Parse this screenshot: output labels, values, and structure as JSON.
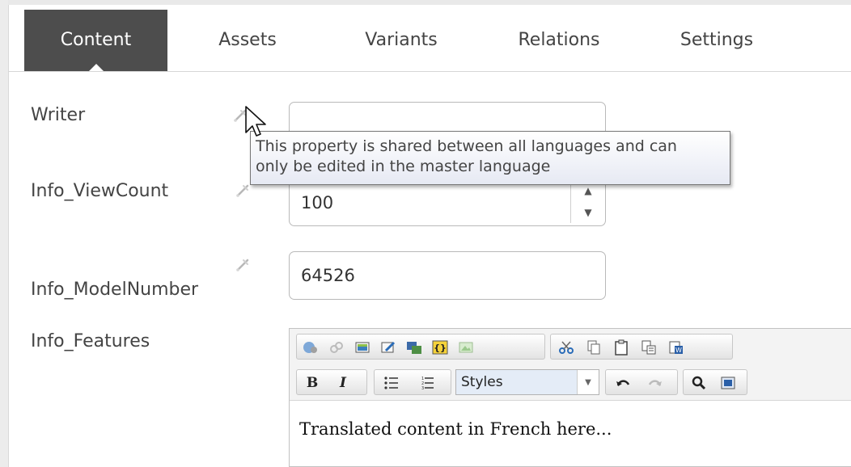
{
  "tabs": [
    {
      "label": "Content",
      "active": true
    },
    {
      "label": "Assets"
    },
    {
      "label": "Variants"
    },
    {
      "label": "Relations"
    },
    {
      "label": "Settings"
    }
  ],
  "fields": {
    "writer": {
      "label": "Writer",
      "value": ""
    },
    "view_count": {
      "label": "Info_ViewCount",
      "value": "100"
    },
    "model_number": {
      "label": "Info_ModelNumber",
      "value": "64526"
    },
    "features": {
      "label": "Info_Features"
    }
  },
  "tooltip": {
    "line1": "This property is shared between all languages and can",
    "line2": "only be edited in the master language"
  },
  "editor": {
    "styles_select": "Styles",
    "bold_label": "B",
    "italic_label": "I",
    "content": "Translated content in French here..."
  },
  "colors": {
    "active_tab_bg": "#4d4d4d",
    "tooltip_bg": "#eef0f7"
  }
}
